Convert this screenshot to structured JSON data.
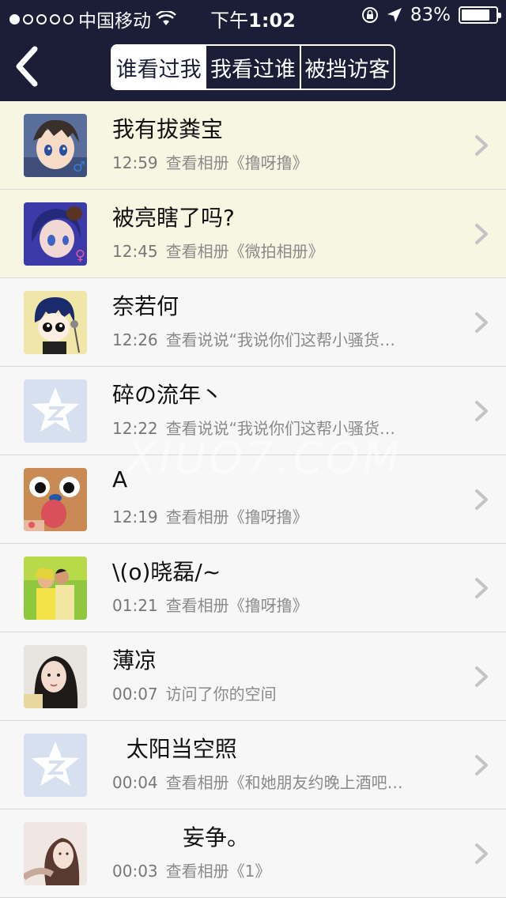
{
  "status_bar": {
    "carrier": "中国移动",
    "time_prefix": "下午",
    "time": "1:02",
    "battery": "83%",
    "battery_level": 0.83,
    "signal_dots_filled": 1,
    "signal_dots_total": 5
  },
  "nav": {
    "tabs": [
      {
        "label": "谁看过我",
        "active": true
      },
      {
        "label": "我看过谁",
        "active": false
      },
      {
        "label": "被挡访客",
        "active": false
      }
    ]
  },
  "visitors": [
    {
      "name": "我有拔粪宝",
      "time": "12:59",
      "action": "查看相册《撸呀撸》",
      "highlight": true,
      "avatar": "anime-boy-avatar",
      "gender": "♂",
      "gender_color": "#3a7bd5"
    },
    {
      "name": "被亮瞎了吗?",
      "time": "12:45",
      "action": "查看相册《微拍相册》",
      "highlight": true,
      "avatar": "anime-girl-avatar",
      "gender": "♀",
      "gender_color": "#e05aa0"
    },
    {
      "name": "奈若何",
      "time": "12:26",
      "action": "查看说说“我说你们这帮小骚货…",
      "highlight": false,
      "avatar": "cartoon-singer-avatar"
    },
    {
      "name": "碎の流年丶",
      "time": "12:22",
      "action": "查看说说“我说你们这帮小骚货…",
      "highlight": false,
      "avatar": "default-qzone-avatar"
    },
    {
      "name": "A",
      "time": "12:19",
      "action": "查看相册《撸呀撸》",
      "highlight": false,
      "avatar": "chopper-avatar"
    },
    {
      "name": "\\(o)晓磊/~",
      "time": "01:21",
      "action": "查看相册《撸呀撸》",
      "highlight": false,
      "avatar": "couple-photo-avatar"
    },
    {
      "name": "薄凉",
      "time": "00:07",
      "action": "访问了你的空间",
      "highlight": false,
      "avatar": "girl-photo-avatar"
    },
    {
      "name": "  太阳当空照",
      "time": "00:04",
      "action": "查看相册《和她朋友约晚上酒吧…",
      "highlight": false,
      "avatar": "default-qzone-avatar"
    },
    {
      "name": "          妄争。",
      "time": "00:03",
      "action": "查看相册《1》",
      "highlight": false,
      "avatar": "girl-portrait-avatar"
    }
  ],
  "watermark": "XIUO7.COM",
  "colors": {
    "header_bg": "#1b1e36",
    "highlight_row": "#f7f6e2",
    "row_bg": "#f7f7f7",
    "meta_text": "#8a8a8a"
  }
}
